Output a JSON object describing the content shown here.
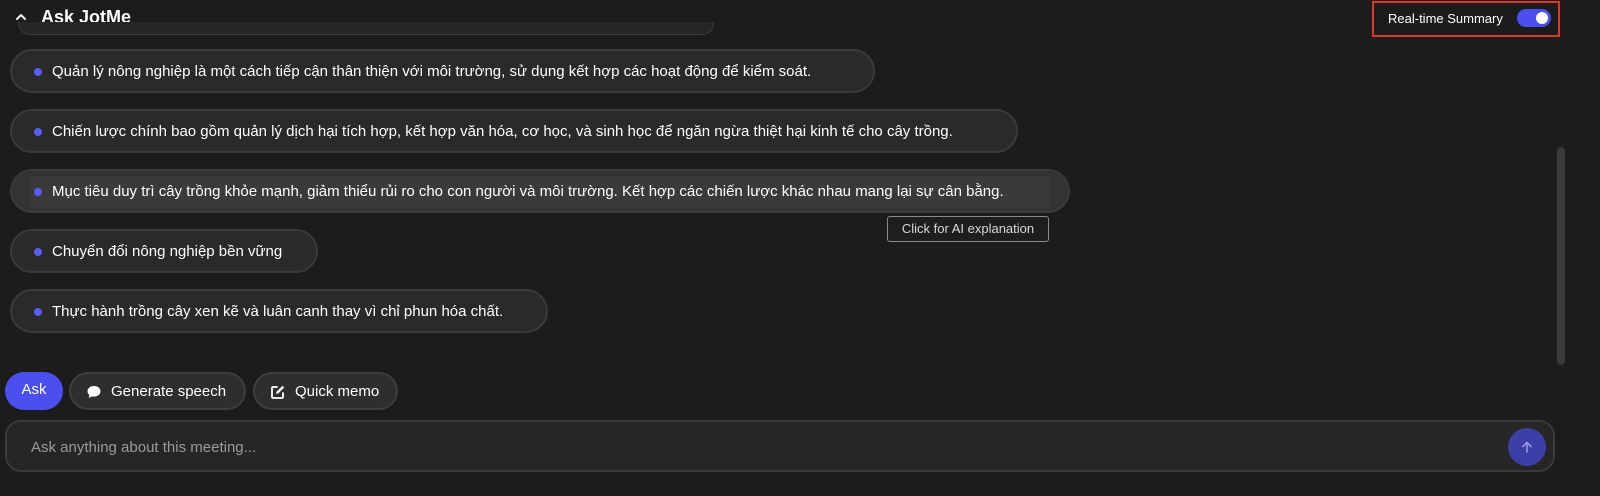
{
  "header": {
    "title": "Ask JotMe",
    "collapse_icon": "chevron-up-icon",
    "realtime_summary": {
      "label": "Real-time Summary",
      "enabled": true,
      "toggle_color": "#4b4ff0",
      "highlight_color": "#d63a2a"
    }
  },
  "summary": {
    "bullet_color": "#5b5cf5",
    "items": [
      {
        "text": "Quản lý nông nghiệp là một cách tiếp cận thân thiện với môi trường, sử dụng kết hợp các hoạt động để kiểm soát."
      },
      {
        "text": "Chiến lược chính bao gồm quản lý dịch hại tích hợp, kết hợp văn hóa, cơ học, và sinh học để ngăn ngừa thiệt hại kinh tế cho cây trồng."
      },
      {
        "text": "Mục tiêu duy trì cây trồng khỏe mạnh, giảm thiểu rủi ro cho con người và môi trường. Kết hợp các chiến lược khác nhau mang lại sự cân bằng."
      },
      {
        "text": "Chuyển đổi nông nghiệp bền vững"
      },
      {
        "text": "Thực hành trồng cây xen kẽ và luân canh thay vì chỉ phun hóa chất."
      }
    ],
    "tooltip": "Click for AI explanation"
  },
  "actions": {
    "ask_label": "Ask",
    "generate_speech_label": "Generate speech",
    "generate_speech_icon": "chat-bubble-icon",
    "quick_memo_label": "Quick memo",
    "quick_memo_icon": "edit-icon",
    "accent_color": "#4b4ff0"
  },
  "input": {
    "placeholder": "Ask anything about this meeting...",
    "value": "",
    "send_icon": "arrow-up-icon"
  }
}
